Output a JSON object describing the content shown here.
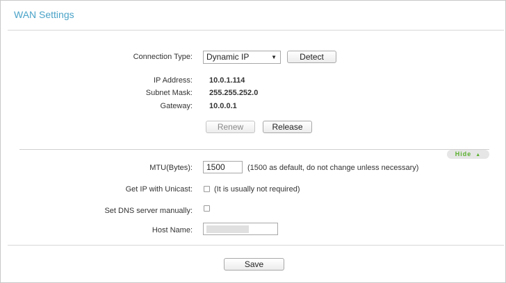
{
  "page": {
    "title": "WAN Settings"
  },
  "connection": {
    "type_label": "Connection Type:",
    "type_value": "Dynamic IP",
    "detect_label": "Detect"
  },
  "status": {
    "ip_label": "IP Address:",
    "ip_value": "10.0.1.114",
    "mask_label": "Subnet Mask:",
    "mask_value": "255.255.252.0",
    "gateway_label": "Gateway:",
    "gateway_value": "10.0.0.1"
  },
  "actions": {
    "renew_label": "Renew",
    "release_label": "Release"
  },
  "advanced": {
    "toggle_label": "Hide",
    "mtu_label": "MTU(Bytes):",
    "mtu_value": "1500",
    "mtu_note": "(1500 as default, do not change unless necessary)",
    "unicast_label": "Get IP with Unicast:",
    "unicast_note": "(It is usually not required)",
    "unicast_checked": false,
    "dns_label": "Set DNS server manually:",
    "dns_checked": false,
    "host_label": "Host Name:",
    "host_value": ""
  },
  "footer": {
    "save_label": "Save"
  },
  "colors": {
    "title": "#4aa3c8",
    "hide_text": "#59b02d"
  },
  "icons": {
    "select_caret": "caret-down-icon",
    "hide_arrow": "chevron-up-icon"
  }
}
